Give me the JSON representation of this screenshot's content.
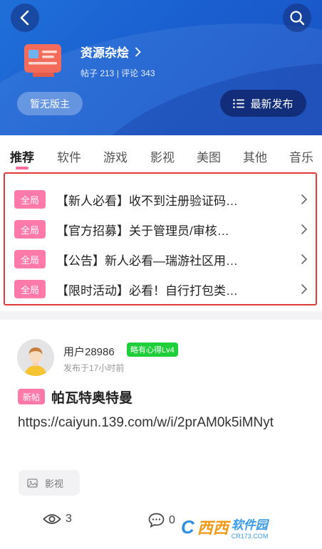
{
  "header": {
    "forum_name": "资源杂烩",
    "stats": "帖子 213 | 评论 343",
    "no_moderator_label": "暂无版主",
    "latest_label": "最新发布"
  },
  "tabs": [
    {
      "label": "推荐"
    },
    {
      "label": "软件"
    },
    {
      "label": "游戏"
    },
    {
      "label": "影视"
    },
    {
      "label": "美图"
    },
    {
      "label": "其他"
    },
    {
      "label": "音乐"
    }
  ],
  "pinned": [
    {
      "tag": "全局",
      "title": "【新人必看】收不到注册验证码…"
    },
    {
      "tag": "全局",
      "title": "【官方招募】关于管理员/审核…"
    },
    {
      "tag": "全局",
      "title": "【公告】新人必看—瑞游社区用…"
    },
    {
      "tag": "全局",
      "title": "【限时活动】必看！自行打包类…"
    }
  ],
  "post": {
    "username": "用户28986",
    "level": "略有心得Lv4",
    "time": "发布于17小时前",
    "new_tag": "新帖",
    "title": "帕瓦特奥特曼",
    "body": "https://caiyun.139.com/w/i/2prAM0k5iMNyt",
    "category": "影视",
    "views": "3",
    "comments": "0"
  },
  "watermark": {
    "brand1": "西西",
    "brand2": "软件园",
    "domain": "CR173.COM"
  },
  "colors": {
    "header_blue": "#1a5fd0",
    "tag_pink": "#ff7aa8",
    "level_green": "#1fcf3a",
    "highlight_red": "#e03a3a"
  }
}
